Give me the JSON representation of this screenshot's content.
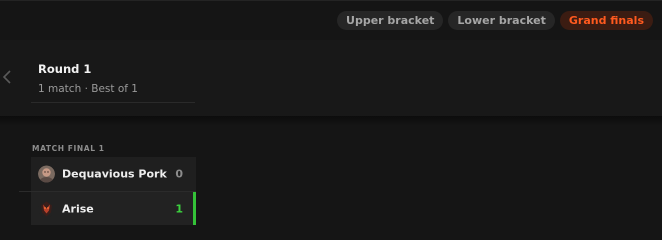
{
  "filters": [
    {
      "label": "Upper bracket",
      "active": false
    },
    {
      "label": "Lower bracket",
      "active": false
    },
    {
      "label": "Grand finals",
      "active": true
    }
  ],
  "round": {
    "title": "Round 1",
    "subtitle": "1 match · Best of 1"
  },
  "match": {
    "label": "MATCH FINAL 1",
    "teams": [
      {
        "name": "Dequavious Pork",
        "score": "0",
        "winner": false,
        "avatar_icon": "player-avatar"
      },
      {
        "name": "Arise",
        "score": "1",
        "winner": true,
        "avatar_icon": "team-logo"
      }
    ]
  },
  "colors": {
    "accent": "#ff5a1f",
    "win": "#3cd23f",
    "background": "#151515"
  }
}
